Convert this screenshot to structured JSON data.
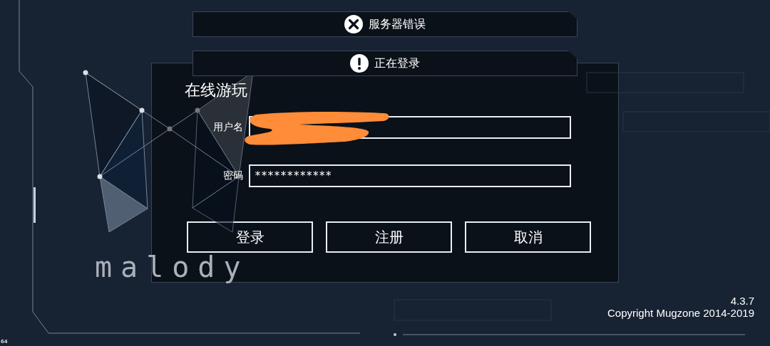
{
  "toasts": [
    {
      "kind": "error",
      "text": "服务器错误"
    },
    {
      "kind": "info",
      "text": "正在登录"
    }
  ],
  "logo": "malody",
  "dialog": {
    "title": "在线游玩",
    "fields": [
      {
        "label": "用户名",
        "redacted": true
      },
      {
        "label": "密码",
        "value": "************",
        "redacted": false
      }
    ],
    "buttons": [
      "登录",
      "注册",
      "取消"
    ]
  },
  "version": "4.3.7",
  "copyright": "Copyright Mugzone 2014-2019",
  "fps": "64"
}
